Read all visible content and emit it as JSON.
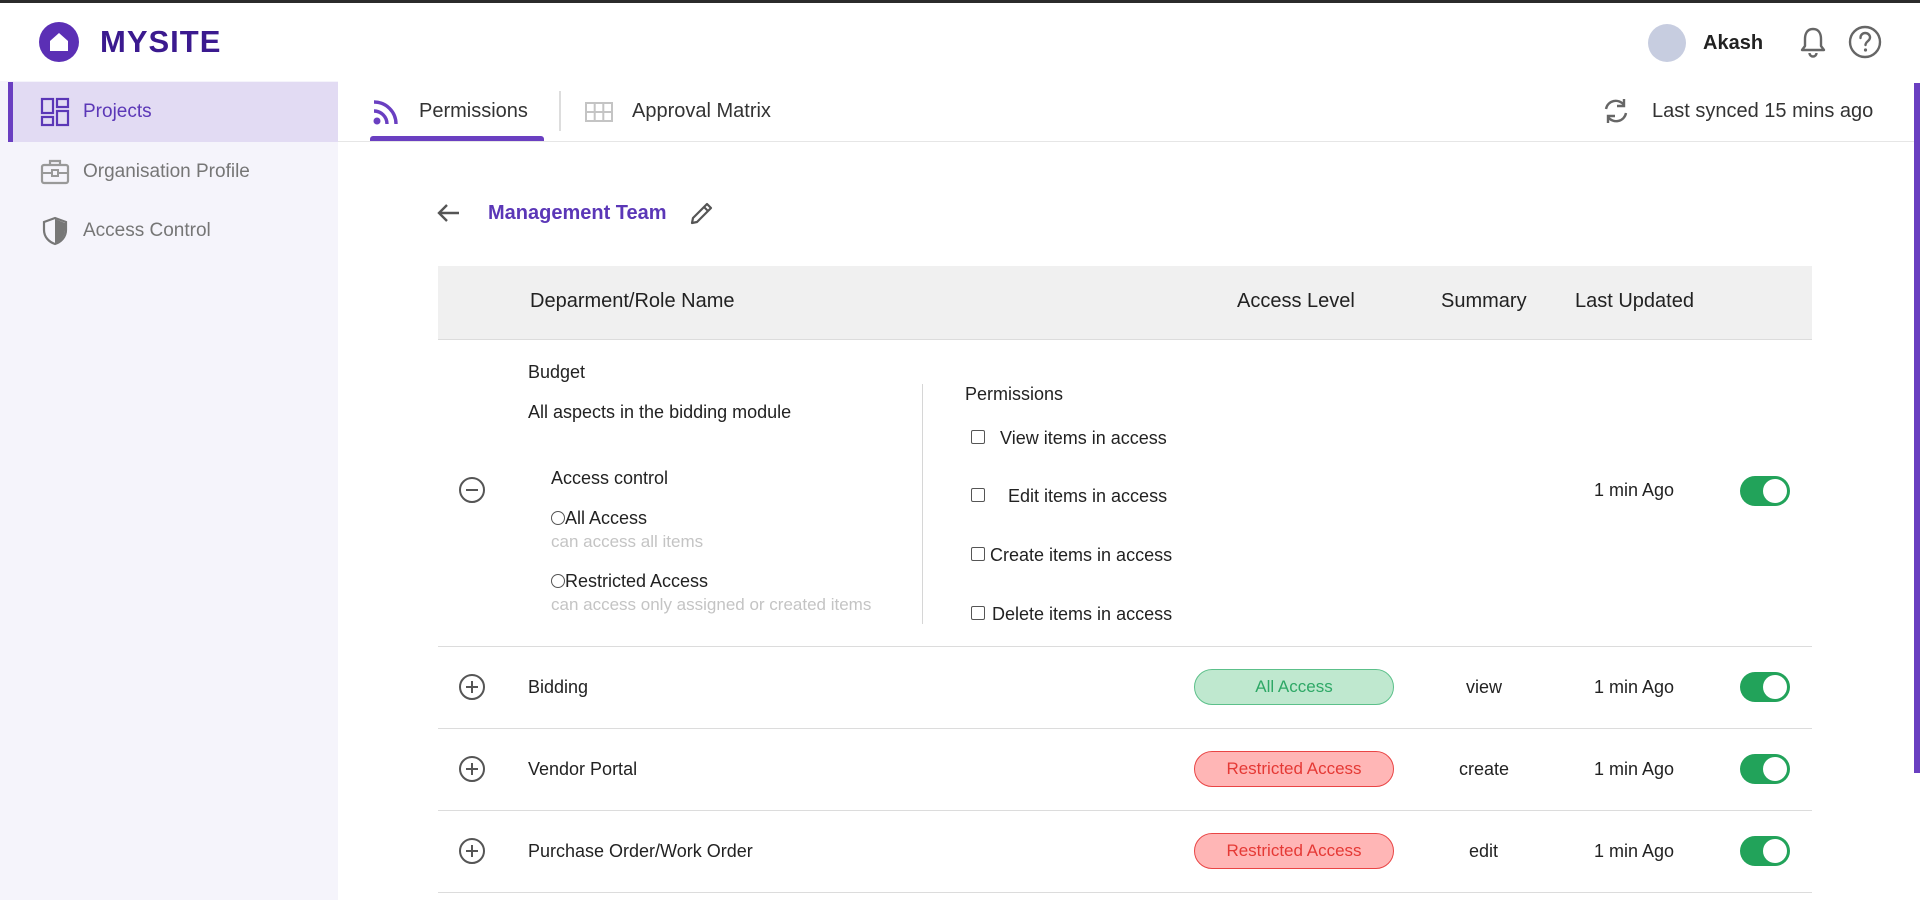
{
  "brand": {
    "name": "MYSITE",
    "color": "#3b1a8f",
    "accent": "#6a3fc1"
  },
  "header": {
    "user_name": "Akash"
  },
  "sidebar": {
    "items": [
      {
        "label": "Projects",
        "icon": "dashboard-icon",
        "active": true
      },
      {
        "label": "Organisation Profile",
        "icon": "briefcase-icon",
        "active": false
      },
      {
        "label": "Access Control",
        "icon": "shield-icon",
        "active": false
      }
    ]
  },
  "tabs": [
    {
      "label": "Permissions",
      "icon": "rss-icon",
      "active": true
    },
    {
      "label": "Approval Matrix",
      "icon": "grid-icon",
      "active": false
    }
  ],
  "sync": {
    "text": "Last synced 15 mins ago"
  },
  "page": {
    "title": "Management Team"
  },
  "table": {
    "columns": {
      "name": "Deparment/Role Name",
      "access": "Access Level",
      "summary": "Summary",
      "updated": "Last Updated"
    },
    "expanded_row": {
      "name": "Budget",
      "description": "All aspects in the bidding module",
      "access_control_label": "Access control",
      "options": [
        {
          "label": "All Access",
          "hint": "can access all items"
        },
        {
          "label": "Restricted Access",
          "hint": "can access only assigned or created items"
        }
      ],
      "permissions_label": "Permissions",
      "permissions": [
        "View items in access",
        "Edit items in access",
        "Create items in access",
        "Delete items in access"
      ],
      "updated": "1 min Ago",
      "enabled": true
    },
    "rows": [
      {
        "name": "Bidding",
        "access": "All Access",
        "access_status": "green",
        "summary": "view",
        "updated": "1 min Ago",
        "enabled": true
      },
      {
        "name": "Vendor Portal",
        "access": "Restricted Access",
        "access_status": "red",
        "summary": "create",
        "updated": "1 min Ago",
        "enabled": true
      },
      {
        "name": "Purchase Order/Work Order",
        "access": "Restricted Access",
        "access_status": "red",
        "summary": "edit",
        "updated": "1 min Ago",
        "enabled": true
      }
    ]
  }
}
